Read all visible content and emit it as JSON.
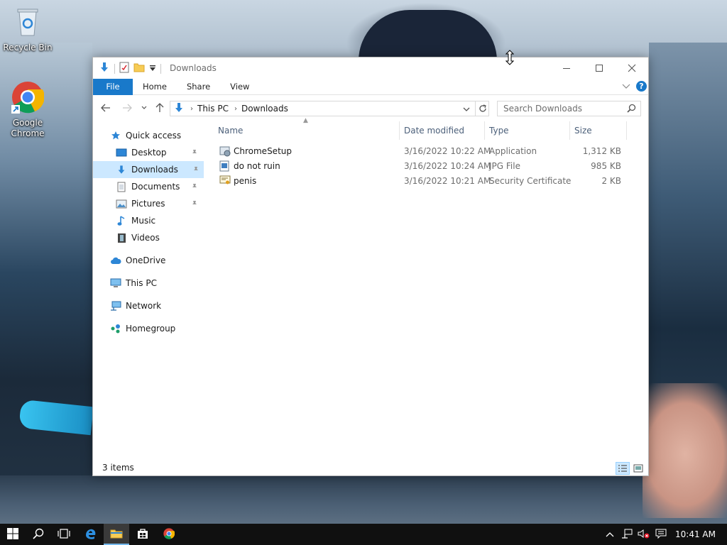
{
  "desktop": {
    "icons": [
      {
        "label": "Recycle Bin"
      },
      {
        "label": "Google Chrome"
      }
    ]
  },
  "window": {
    "title": "Downloads",
    "ribbon_tabs": [
      "File",
      "Home",
      "Share",
      "View"
    ],
    "address": {
      "crumbs": [
        "This PC",
        "Downloads"
      ]
    },
    "search": {
      "placeholder": "Search Downloads"
    },
    "nav": {
      "items": [
        {
          "label": "Quick access"
        },
        {
          "label": "Desktop"
        },
        {
          "label": "Downloads"
        },
        {
          "label": "Documents"
        },
        {
          "label": "Pictures"
        },
        {
          "label": "Music"
        },
        {
          "label": "Videos"
        },
        {
          "label": "OneDrive"
        },
        {
          "label": "This PC"
        },
        {
          "label": "Network"
        },
        {
          "label": "Homegroup"
        }
      ]
    },
    "columns": [
      "Name",
      "Date modified",
      "Type",
      "Size"
    ],
    "files": [
      {
        "name": "ChromeSetup",
        "date": "3/16/2022 10:22 AM",
        "type": "Application",
        "size": "1,312 KB"
      },
      {
        "name": "do not ruin",
        "date": "3/16/2022 10:24 AM",
        "type": "JPG File",
        "size": "985 KB"
      },
      {
        "name": "penis",
        "date": "3/16/2022 10:21 AM",
        "type": "Security Certificate",
        "size": "2 KB"
      }
    ],
    "status": "3 items"
  },
  "taskbar": {
    "clock": "10:41 AM"
  },
  "colors": {
    "accent": "#1979ca",
    "selection": "#cce8ff",
    "taskbar": "#101010"
  }
}
